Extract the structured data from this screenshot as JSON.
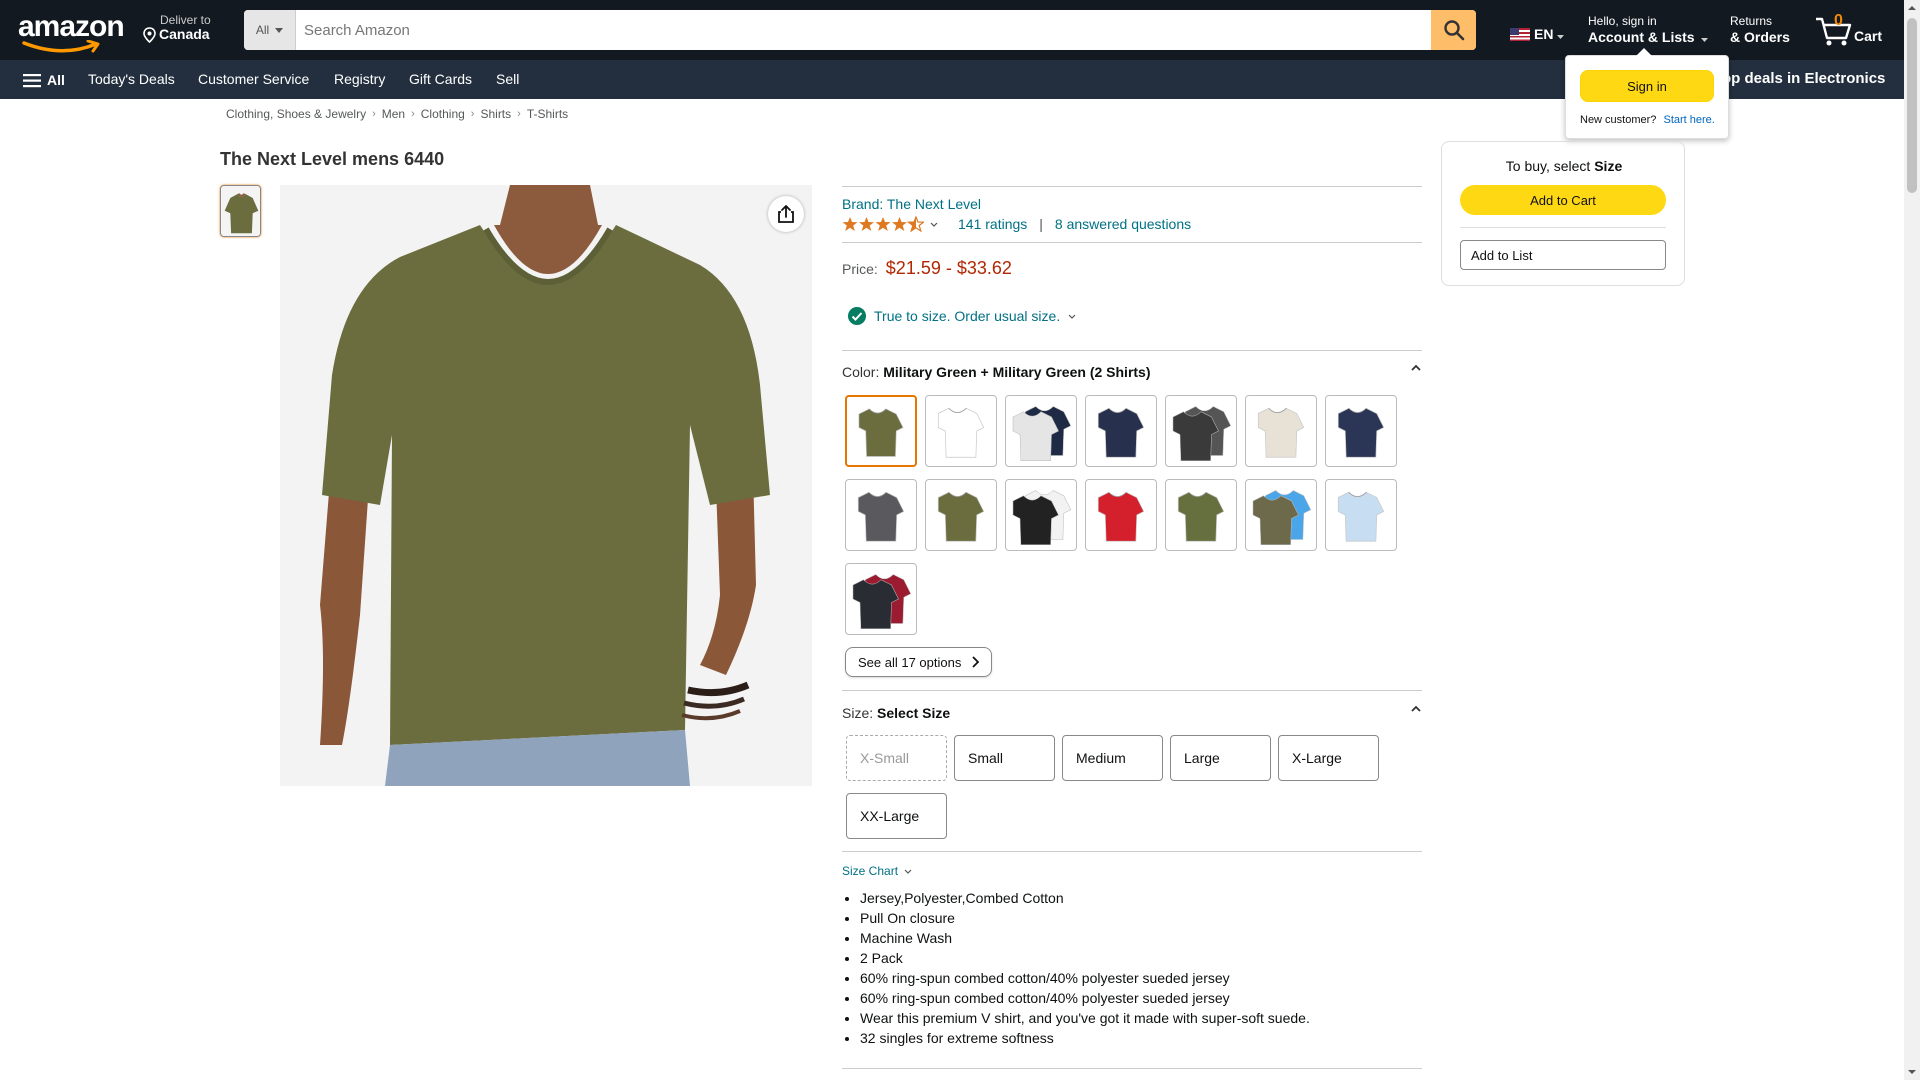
{
  "header": {
    "logo": "amazon",
    "deliver_to_label": "Deliver to",
    "deliver_to_location": "Canada",
    "search": {
      "category": "All",
      "placeholder": "Search Amazon"
    },
    "language": "EN",
    "account_greeting": "Hello, sign in",
    "account_label": "Account & Lists",
    "returns_label": "Returns",
    "orders_label": "& Orders",
    "cart_count": "0",
    "cart_label": "Cart"
  },
  "subnav": {
    "all_label": "All",
    "items": [
      "Today's Deals",
      "Customer Service",
      "Registry",
      "Gift Cards",
      "Sell"
    ],
    "promo": "op deals in Electronics"
  },
  "signin_flyout": {
    "button": "Sign in",
    "new_customer": "New customer?",
    "start_here": "Start here."
  },
  "breadcrumb": [
    "Clothing, Shoes & Jewelry",
    "Men",
    "Clothing",
    "Shirts",
    "T-Shirts"
  ],
  "product": {
    "title": "The Next Level mens 6440",
    "brand": "Brand: The Next Level",
    "rating_stars": 4.5,
    "ratings_count": "141 ratings",
    "answered_questions": "8 answered questions",
    "price_label": "Price:",
    "price": "$21.59 - $33.62",
    "fit": "True to size. Order usual size.",
    "color_label": "Color:",
    "color_value": "Military Green + Military Green (2 Shirts)",
    "swatches": [
      {
        "shirt": "#6b6d3f",
        "second": "#6b6d3f",
        "selected": true
      },
      {
        "shirt": "#ffffff",
        "second": "#ffffff"
      },
      {
        "shirt": "#e5e5e5",
        "second": "#1f2a44"
      },
      {
        "shirt": "#27304d",
        "second": "#27304d"
      },
      {
        "shirt": "#3a3a3a",
        "second": "#555555"
      },
      {
        "shirt": "#e8e2d6",
        "second": "#e8e2d6"
      },
      {
        "shirt": "#2b3656",
        "second": "#2b3656"
      },
      {
        "shirt": "#5a5a5e",
        "second": "#5a5a5e"
      },
      {
        "shirt": "#6b6d3f",
        "second": "#6b6d3f"
      },
      {
        "shirt": "#222222",
        "second": "#f2f2f2"
      },
      {
        "shirt": "#d4202d",
        "second": "#d4202d"
      },
      {
        "shirt": "#66703f",
        "second": "#66703f"
      },
      {
        "shirt": "#6c6a4a",
        "second": "#4aa6e8"
      },
      {
        "shirt": "#c7ddf2",
        "second": "#c7ddf2"
      },
      {
        "shirt": "#2a2c33",
        "second": "#9b1b30"
      }
    ],
    "see_all_options": "See all 17 options",
    "size_label": "Size:",
    "size_value": "Select Size",
    "sizes": [
      {
        "label": "X-Small",
        "disabled": true
      },
      {
        "label": "Small"
      },
      {
        "label": "Medium"
      },
      {
        "label": "Large"
      },
      {
        "label": "X-Large"
      },
      {
        "label": "XX-Large"
      }
    ],
    "size_chart": "Size Chart",
    "bullets": [
      "Jersey,Polyester,Combed Cotton",
      "Pull On closure",
      "Machine Wash",
      "2 Pack",
      "60% ring-spun combed cotton/40% polyester sueded jersey",
      "60% ring-spun combed cotton/40% polyester sueded jersey",
      "Wear this premium V shirt, and you've got it made with super-soft suede.",
      "32 singles for extreme softness"
    ]
  },
  "buybox": {
    "message_prefix": "To buy, select",
    "message_bold": "Size",
    "add_to_cart": "Add to Cart",
    "add_to_list": "Add to List"
  },
  "colors": {
    "nav_dark": "#131921",
    "nav_sub": "#232f3e",
    "search_btn": "#febd69",
    "cart_orange": "#f08804",
    "link": "#007185",
    "price_red": "#b12704",
    "button_yellow": "#ffd814",
    "shirt_green": "#6b6d3f"
  }
}
